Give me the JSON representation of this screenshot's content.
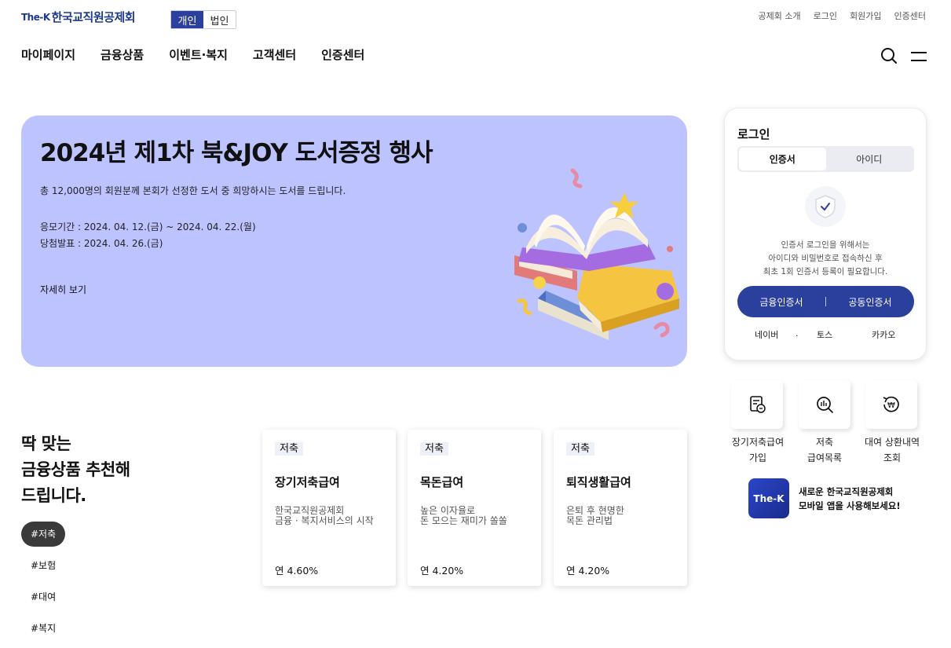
{
  "header": {
    "logo_prefix": "The-K",
    "logo_name": "한국교직원공제회",
    "member_types": [
      "개인",
      "법인"
    ],
    "util_links": [
      "공제회 소개",
      "로그인",
      "회원가입",
      "인증센터"
    ],
    "gnb": [
      "마이페이지",
      "금융상품",
      "이벤트·복지",
      "고객센터",
      "인증센터"
    ]
  },
  "banner": {
    "title": "2024년 제1차 북&JOY 도서증정 행사",
    "description": "총 12,000명의 회원분께 본회가 선정한 도서 중 희망하시는 도서를 드립니다.",
    "apply_period": "응모기간 : 2024. 04. 12.(금) ~ 2024. 04. 22.(월)",
    "announce_date": "당첨발표 : 2024. 04. 26.(금)",
    "more_label": "자세히 보기",
    "bg_color": "#bcc3ff"
  },
  "login": {
    "title": "로그인",
    "tabs": [
      "인증서",
      "아이디"
    ],
    "info_lines": [
      "인증서 로그인을 위해서는",
      "아이디와 비밀번호로 접속하신 후",
      "최초 1회 인증서 등록이 필요합니다."
    ],
    "buttons": [
      "금융인증서",
      "공동인증서"
    ],
    "social": [
      "네이버",
      ".",
      "토스",
      "카카오"
    ],
    "accent": "#2b3f9d"
  },
  "quick_menu": [
    {
      "icon": "document-savings-icon",
      "label_line1": "장기저축급여",
      "label_line2": "가입"
    },
    {
      "icon": "search-doc-icon",
      "label_line1": "저축",
      "label_line2": "급여목록"
    },
    {
      "icon": "history-won-icon",
      "label_line1": "대여 상환내역",
      "label_line2": "조회"
    }
  ],
  "app_promo": {
    "icon_text": "The-K",
    "line1": "새로운 한국교직원공제회",
    "line2": "모바일 앱을 사용해보세요!"
  },
  "recommend": {
    "title_lines": [
      "딱 맞는",
      "금융상품 추천해",
      "드립니다."
    ],
    "tags": [
      "#저축",
      "#보험",
      "#대여",
      "#복지"
    ],
    "products": [
      {
        "badge": "저축",
        "name": "장기저축급여",
        "desc1": "한국교직원공제회",
        "desc2": "금융 · 복지서비스의 시작",
        "rate": "연 4.60%"
      },
      {
        "badge": "저축",
        "name": "목돈급여",
        "desc1": "높은 이자율로",
        "desc2": "돈 모으는 재미가 쏠쏠",
        "rate": "연 4.20%"
      },
      {
        "badge": "저축",
        "name": "퇴직생활급여",
        "desc1": "은퇴 후 현명한",
        "desc2": "목돈 관리법",
        "rate": "연 4.20%"
      }
    ]
  }
}
